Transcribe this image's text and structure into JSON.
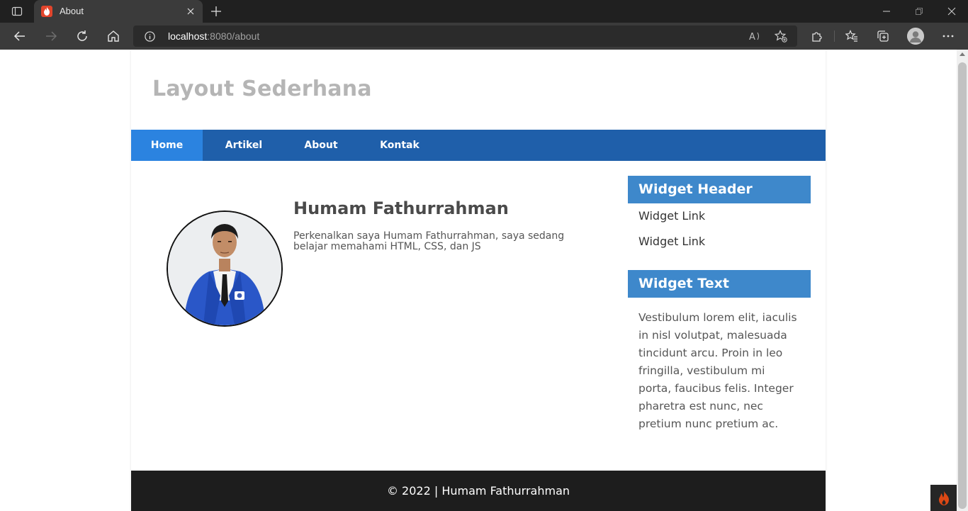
{
  "browser": {
    "tab": {
      "title": "About"
    },
    "url": {
      "host": "localhost",
      "path": ":8080/about"
    }
  },
  "site": {
    "title": "Layout Sederhana",
    "nav": [
      {
        "label": "Home",
        "active": true
      },
      {
        "label": "Artikel",
        "active": false
      },
      {
        "label": "About",
        "active": false
      },
      {
        "label": "Kontak",
        "active": false
      }
    ]
  },
  "main": {
    "name": "Humam Fathurrahman",
    "bio": "Perkenalkan saya Humam Fathurrahman, saya sedang belajar memahami HTML, CSS, dan JS"
  },
  "sidebar": {
    "widget1": {
      "header": "Widget Header",
      "links": [
        "Widget Link",
        "Widget Link"
      ]
    },
    "widget2": {
      "header": "Widget Text",
      "text": "Vestibulum lorem elit, iaculis in nisl volutpat, malesuada tincidunt arcu. Proin in leo fringilla, vestibulum mi porta, faucibus felis. Integer pharetra est nunc, nec pretium nunc pretium ac."
    }
  },
  "footer": {
    "text": "© 2022 | Humam Fathurrahman"
  },
  "colors": {
    "nav": "#1f5faa",
    "nav_active": "#2b83e0",
    "widget_header": "#3e88cb",
    "footer": "#1d1d1d",
    "title": "#b5b5b5"
  },
  "icons": [
    "tab-actions-icon",
    "codeigniter-favicon-icon",
    "close-icon",
    "plus-icon",
    "minimize-icon",
    "restore-icon",
    "back-icon",
    "forward-icon",
    "refresh-icon",
    "home-icon",
    "info-icon",
    "read-aloud-icon",
    "add-favorite-icon",
    "extensions-icon",
    "favorites-icon",
    "collections-icon",
    "profile-icon",
    "more-icon",
    "codeigniter-toolbar-icon"
  ]
}
